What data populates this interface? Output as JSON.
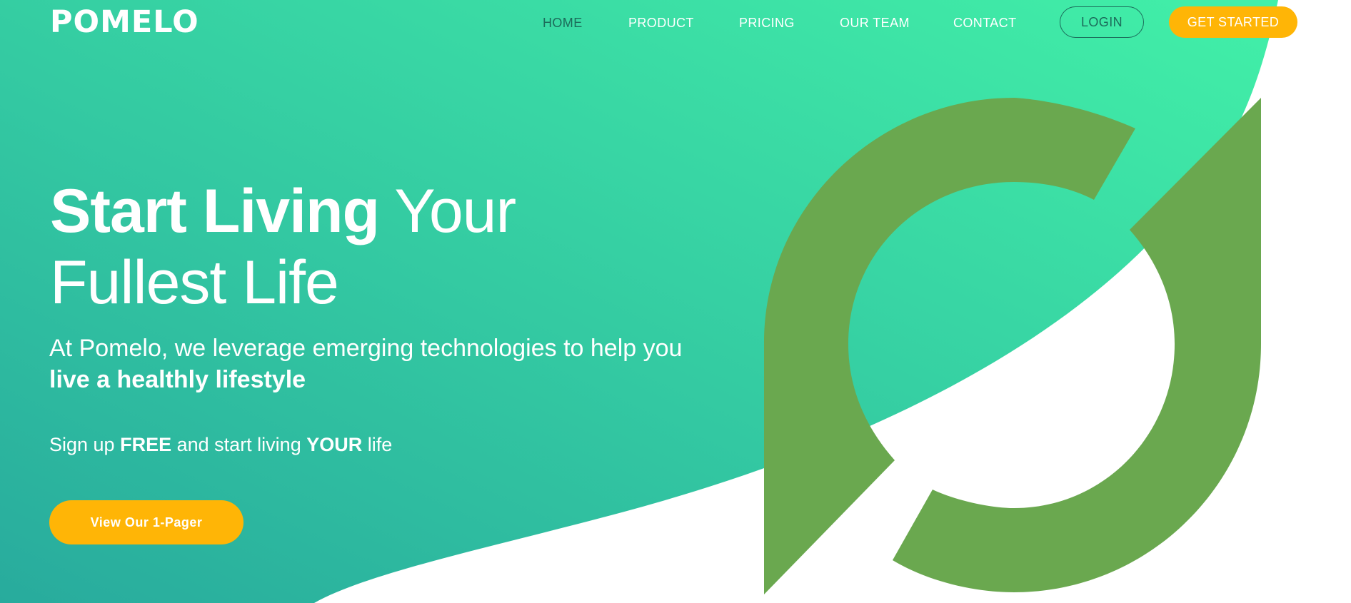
{
  "brand": {
    "logo_text": "POMELO"
  },
  "nav": {
    "items": [
      {
        "label": "HOME",
        "active": true
      },
      {
        "label": "PRODUCT",
        "active": false
      },
      {
        "label": "PRICING",
        "active": false
      },
      {
        "label": "OUR TEAM",
        "active": false
      },
      {
        "label": "CONTACT",
        "active": false
      }
    ],
    "login_label": "LOGIN",
    "get_started_label": "GET STARTED"
  },
  "hero": {
    "headline_bold": "Start Living",
    "headline_light_1": "Your",
    "headline_light_2": "Fullest Life",
    "subline_regular": "At Pomelo, we leverage emerging technologies to help you",
    "subline_bold": "live a healthly lifestyle",
    "signup_1": "Sign up",
    "signup_2": "FREE",
    "signup_3": "and start living",
    "signup_4": "YOUR",
    "signup_5": "life",
    "cta_label": "View Our 1-Pager"
  },
  "colors": {
    "gradient_start": "#28ab9d",
    "gradient_end": "#42f0a8",
    "accent_yellow": "#ffb506",
    "mark_green": "#6aa84f",
    "nav_active": "#1c6b5a"
  }
}
